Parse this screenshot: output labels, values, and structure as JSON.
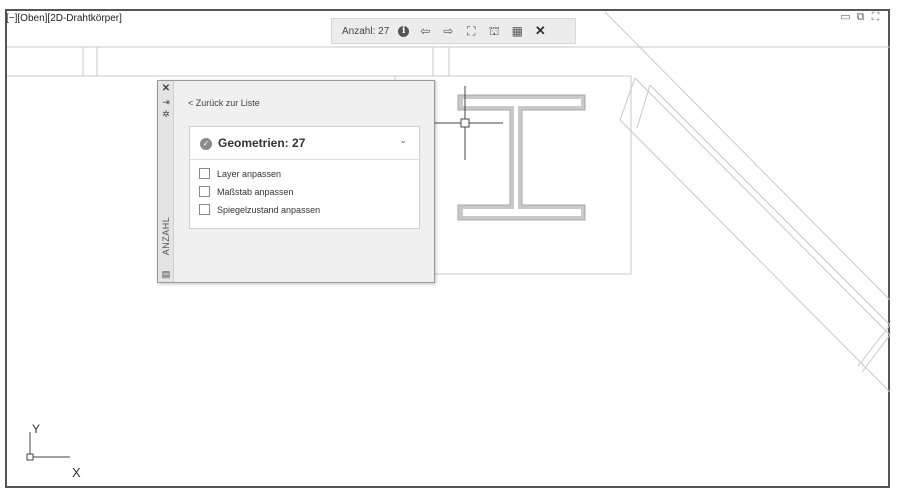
{
  "viewport": {
    "label": "[−][Oben][2D-Drahtkörper]",
    "window_controls": [
      "minimize-icon",
      "restore-icon",
      "maximize-icon"
    ]
  },
  "toolbar": {
    "count_label": "Anzahl: 27",
    "icons": [
      "info-icon",
      "previous-arrow-icon",
      "next-arrow-icon",
      "zoom-extents-icon",
      "replace-block-icon",
      "insert-count-table-icon",
      "close-icon"
    ]
  },
  "palette": {
    "title": "ANZAHL",
    "back_link": "< Zurück zur Liste",
    "group_title": "Geometrien: 27",
    "options": [
      {
        "label": "Layer anpassen",
        "checked": false
      },
      {
        "label": "Maßstab anpassen",
        "checked": false
      },
      {
        "label": "Spiegelzustand anpassen",
        "checked": false
      }
    ],
    "strip_icons": [
      "close-icon",
      "autohide-icon",
      "properties-icon",
      "menu-icon"
    ]
  },
  "ucs": {
    "x_label": "X",
    "y_label": "Y"
  }
}
